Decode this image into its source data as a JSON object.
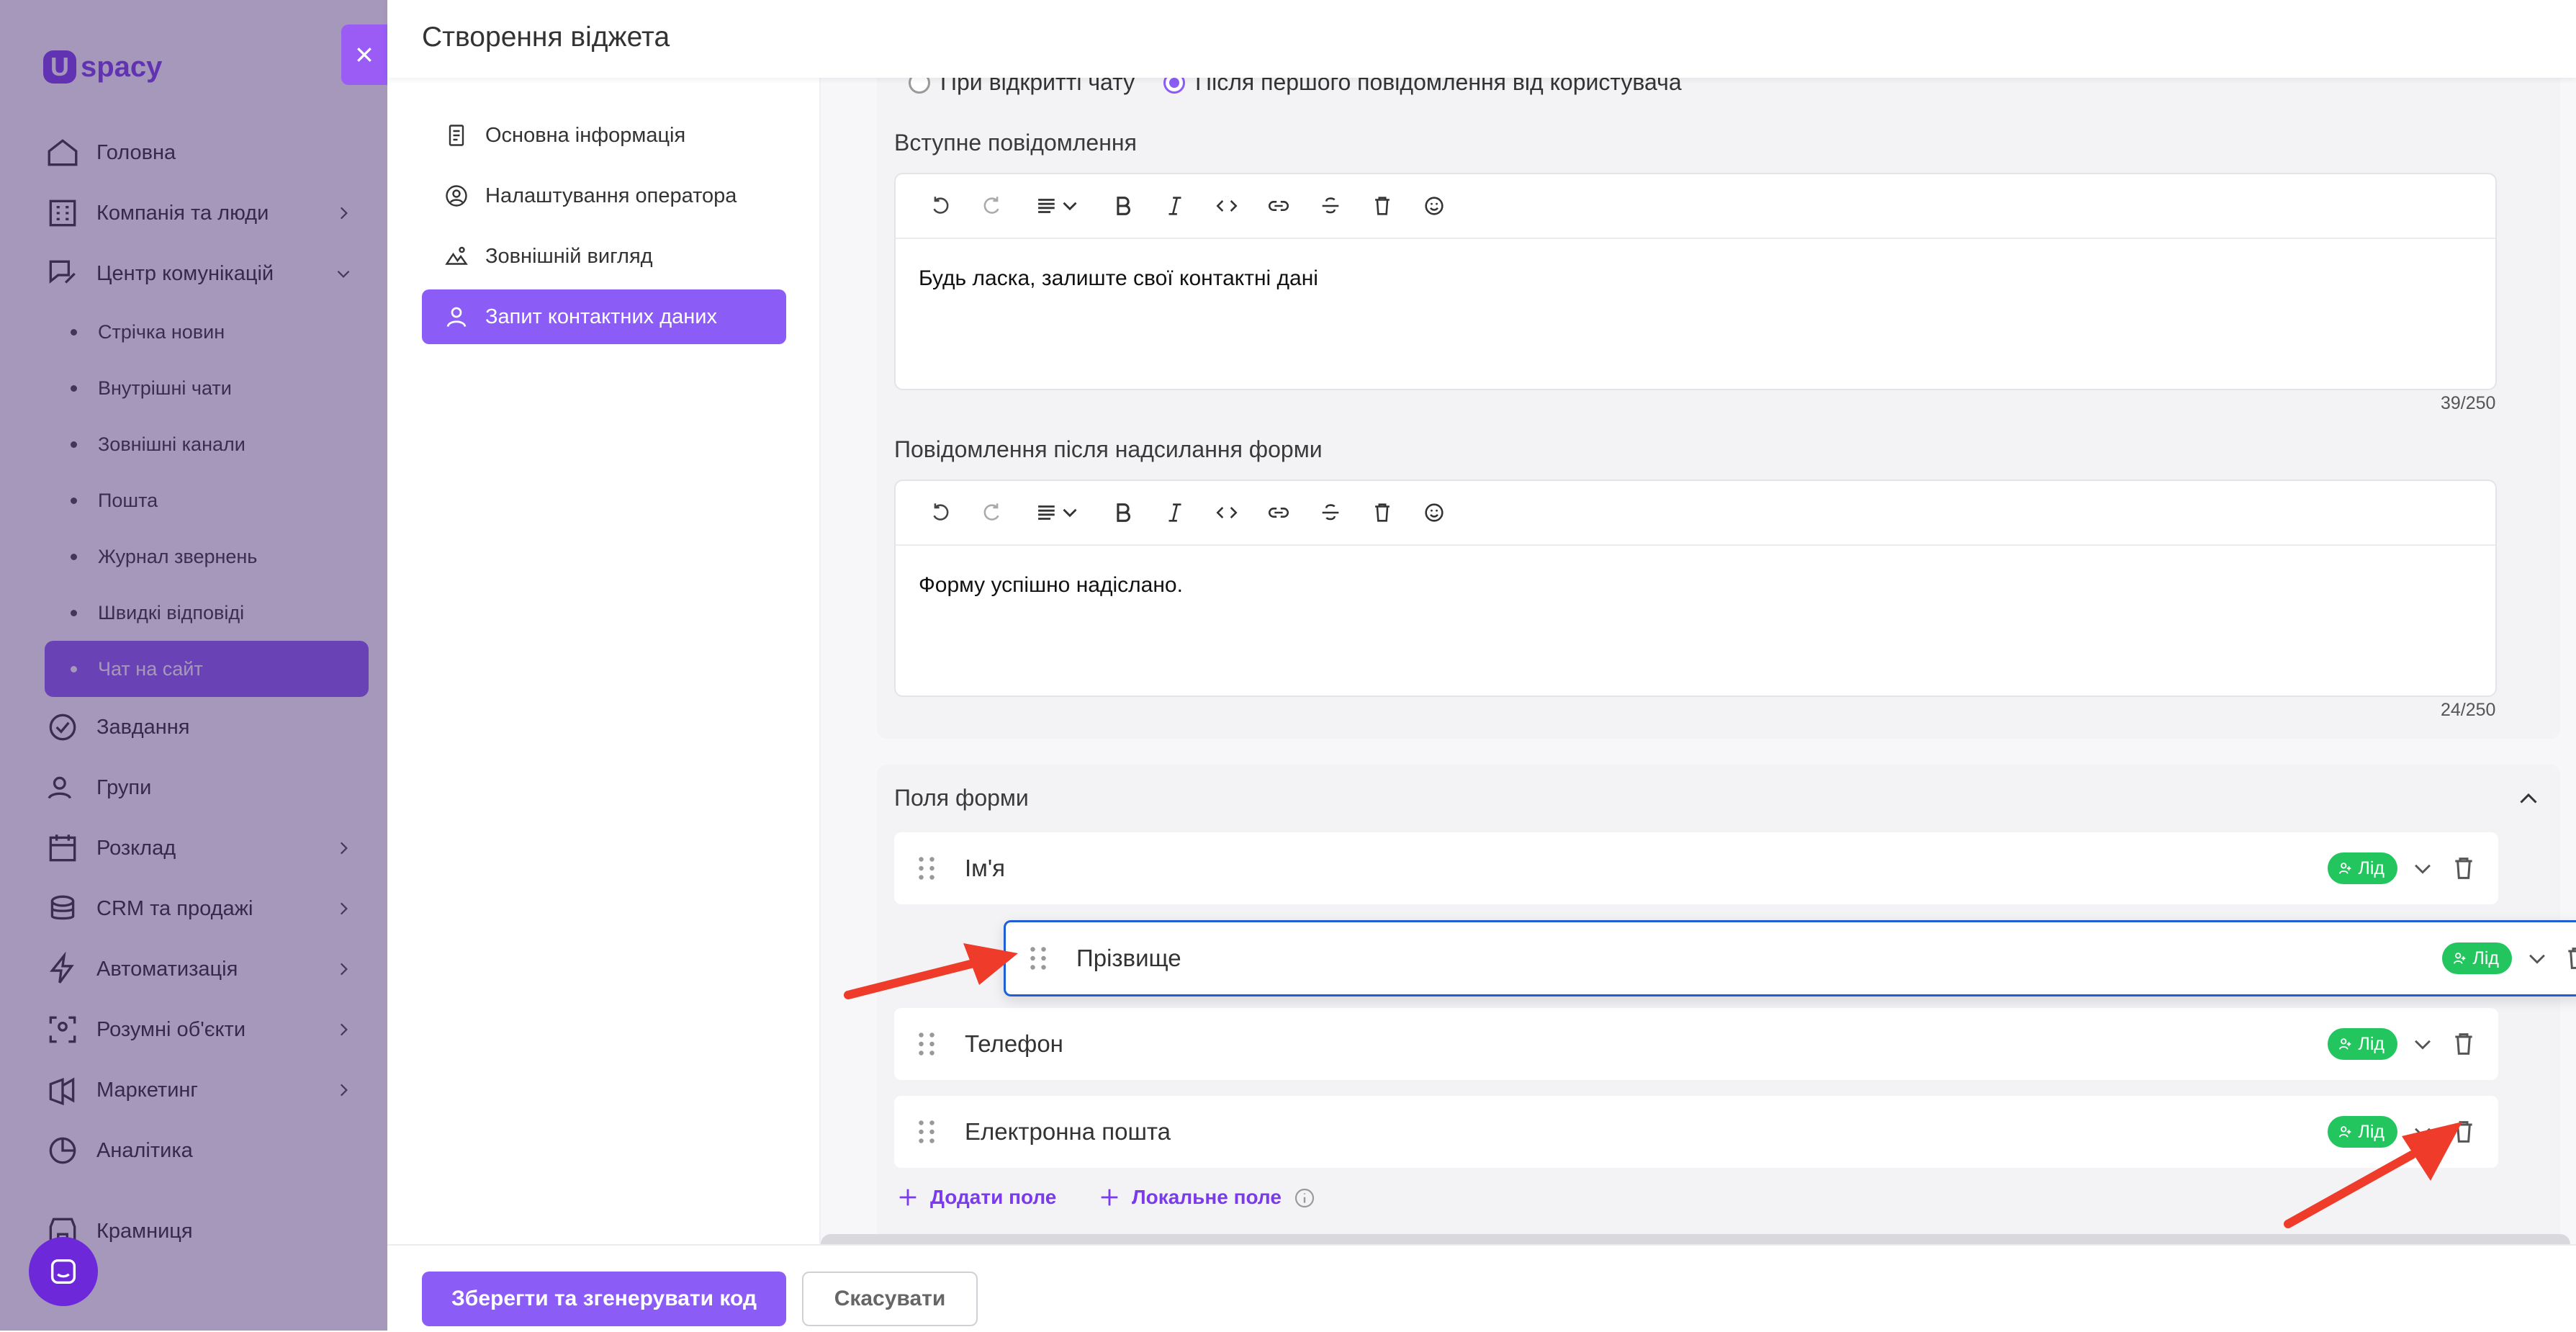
{
  "app": {
    "logo_text": "spacy",
    "logo_mark": "U",
    "nav": [
      {
        "label": "Головна",
        "icon": "home-icon",
        "has_arrow": false
      },
      {
        "label": "Компанія та люди",
        "icon": "building-icon",
        "has_arrow": true
      },
      {
        "label": "Центр комунікацій",
        "icon": "chat-edit-icon",
        "has_arrow": true,
        "expanded": true
      }
    ],
    "subnav": [
      "Стрічка новин",
      "Внутрішні чати",
      "Зовнішні канали",
      "Пошта",
      "Журнал звернень",
      "Швидкі відповіді",
      "Чат на сайт"
    ],
    "nav_after": [
      {
        "label": "Завдання",
        "icon": "check-circle-icon",
        "has_arrow": false
      },
      {
        "label": "Групи",
        "icon": "users-icon",
        "has_arrow": false
      },
      {
        "label": "Розклад",
        "icon": "calendar-icon",
        "has_arrow": true
      },
      {
        "label": "CRM та продажі",
        "icon": "coins-icon",
        "has_arrow": true
      },
      {
        "label": "Автоматизація",
        "icon": "lightning-icon",
        "has_arrow": true
      },
      {
        "label": "Розумні об'єкти",
        "icon": "smart-object-icon",
        "has_arrow": true
      },
      {
        "label": "Маркетинг",
        "icon": "marketing-icon",
        "has_arrow": true
      },
      {
        "label": "Аналітика",
        "icon": "analytics-icon",
        "has_arrow": false
      },
      {
        "label": "Крамниця",
        "icon": "store-icon",
        "has_arrow": false
      }
    ]
  },
  "drawer": {
    "title": "Створення віджета",
    "steps": [
      {
        "label": "Основна інформація",
        "icon": "document-icon",
        "active": false
      },
      {
        "label": "Налаштування оператора",
        "icon": "operator-icon",
        "active": false
      },
      {
        "label": "Зовнішній вигляд",
        "icon": "appearance-icon",
        "active": false
      },
      {
        "label": "Запит контактних даних",
        "icon": "user-icon",
        "active": true
      }
    ],
    "timing": {
      "option_1": "При відкритті чату",
      "option_2": "Після першого повідомлення від користувача",
      "selected": "option_2"
    },
    "intro_message": {
      "label": "Вступне повідомлення",
      "text": "Будь ласка, залиште свої контактні дані",
      "counter": "39/250"
    },
    "after_submit_message": {
      "label": "Повідомлення після надсилання форми",
      "text": "Форму успішно надіслано.",
      "counter": "24/250"
    },
    "form_fields": {
      "label": "Поля форми",
      "items": [
        {
          "label": "Ім'я",
          "badge": "Лід"
        },
        {
          "label": "Прізвище",
          "badge": "Лід",
          "dragging": true
        },
        {
          "label": "Телефон",
          "badge": "Лід"
        },
        {
          "label": "Електронна пошта",
          "badge": "Лід"
        }
      ],
      "add_field": "Додати поле",
      "local_field": "Локальне поле"
    },
    "footer": {
      "save": "Зберегти та згенерувати код",
      "cancel": "Скасувати"
    }
  },
  "colors": {
    "accent": "#8b5cf6",
    "badge": "#22c55e",
    "drag_border": "#1e5fd6",
    "callout_arrow": "#ef3b2a"
  }
}
